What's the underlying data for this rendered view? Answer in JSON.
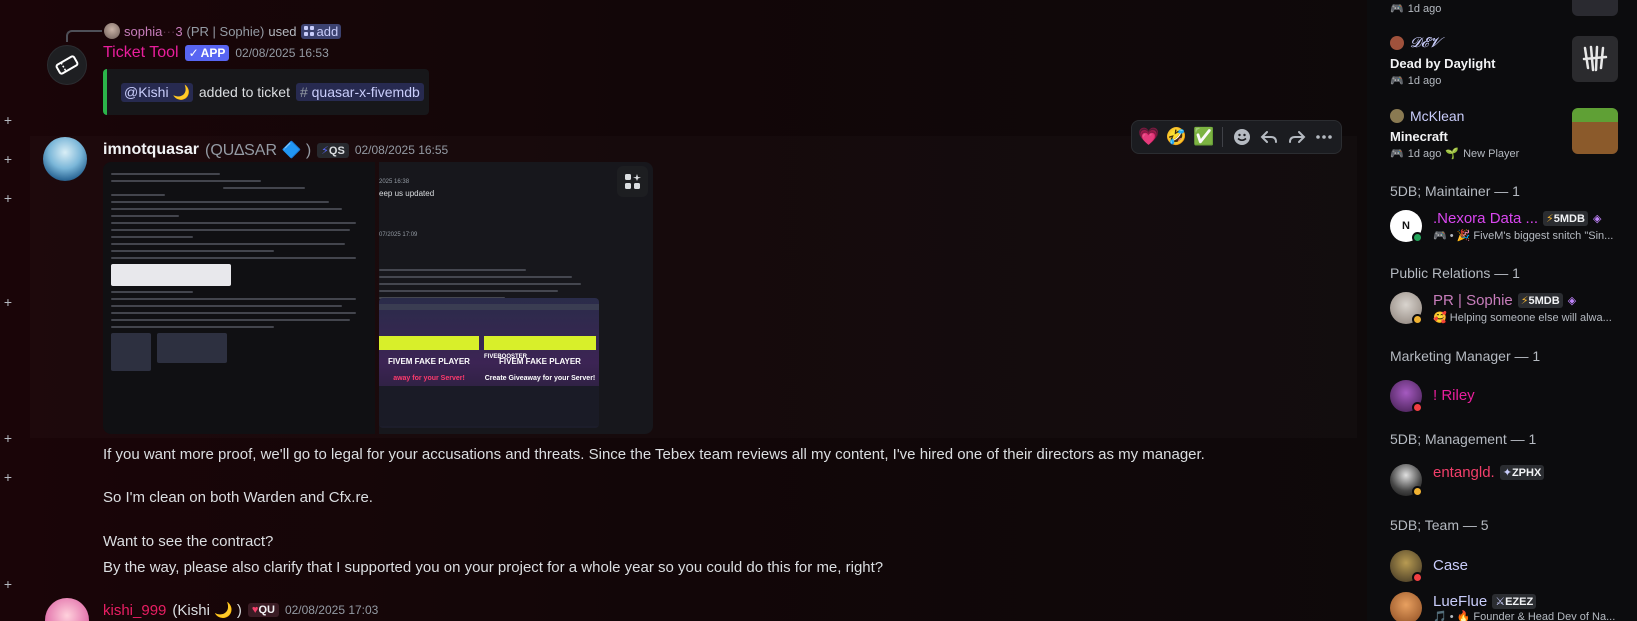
{
  "gutter": [
    "+",
    "+",
    "+",
    "+",
    "+",
    "+",
    "+"
  ],
  "messages": {
    "ticket": {
      "reply_user": "sophia",
      "reply_user_tail": "3",
      "reply_sub": "(PR | Sophie)",
      "reply_used": "used",
      "command": "add",
      "author": "Ticket Tool",
      "app_badge": "APP",
      "timestamp": "02/08/2025 16:53",
      "embed_mention": "@Kishi 🌙",
      "embed_text": "added to ticket",
      "embed_channel": "quasar-x-fivemdb"
    },
    "quasar": {
      "author": "imnotquasar",
      "author_sub": "(QU∆SAR 🔷 )",
      "tag": "QS",
      "timestamp": "02/08/2025 16:55",
      "image_right_texts": [
        "2025 16:38",
        "eep us updated",
        "07/2025 17:09"
      ],
      "banner": {
        "row1": "FIVEM FAKE PLAYER",
        "row2": "FIVEM FAKE PLAYER",
        "cta1": "away for your Server!",
        "cta2": "Create Giveaway for your Server!",
        "left_brand": "FIVEBOOSTER"
      },
      "lines": [
        "If you want more proof, we'll go to legal for your accusations and threats. Since the Tebex team reviews all my content, I've hired one of their directors as my manager.",
        "So I'm clean on both Warden and Cfx.re.",
        "Want to see the contract?",
        "By the way, please also clarify that I supported you on your project for a whole year so you could do this for me, right?"
      ]
    },
    "kishi": {
      "author": "kishi_999",
      "author_sub": "(Kishi 🌙 )",
      "tag": "QU",
      "timestamp": "02/08/2025 17:03"
    }
  },
  "toolbar": {
    "reactions": [
      "💗",
      "🤣",
      "✅"
    ],
    "actions": [
      "add-reaction",
      "reply",
      "forward",
      "more"
    ]
  },
  "members": {
    "top_meta": "1d ago",
    "activities": [
      {
        "user": "𝓓𝓔𝓥",
        "game": "Dead by Daylight",
        "meta": "1d ago"
      },
      {
        "user": "McKlean",
        "game": "Minecraft",
        "meta": "1d ago",
        "extra": "New Player"
      }
    ],
    "sections": [
      {
        "title": "5DB; Maintainer — 1",
        "members": [
          {
            "name": ".Nexora Data ...",
            "tag": "5MDB",
            "sub": "🎮 • 🎉 FiveM's biggest snitch \"Sin...",
            "color": "#d946ef"
          }
        ]
      },
      {
        "title": "Public Relations — 1",
        "members": [
          {
            "name": "PR | Sophie",
            "tag": "5MDB",
            "sub": "🥰 Helping someone else will alwa...",
            "color": "#c77dbb"
          }
        ]
      },
      {
        "title": "Marketing Manager — 1",
        "members": [
          {
            "name": "! Riley",
            "color": "#e91e9c"
          }
        ]
      },
      {
        "title": "5DB; Management — 1",
        "members": [
          {
            "name": "entangld.",
            "tag": "ZPHX",
            "sub": "",
            "color": "#f23f6a"
          }
        ]
      },
      {
        "title": "5DB; Team — 5",
        "members": [
          {
            "name": "Case",
            "color": "#c9cdfb"
          },
          {
            "name": "LueFlue",
            "tag": "EZEZ",
            "sub": "🎵 • 🔥 Founder & Head Dev of Na...",
            "color": "#c9cdfb"
          }
        ]
      }
    ]
  }
}
